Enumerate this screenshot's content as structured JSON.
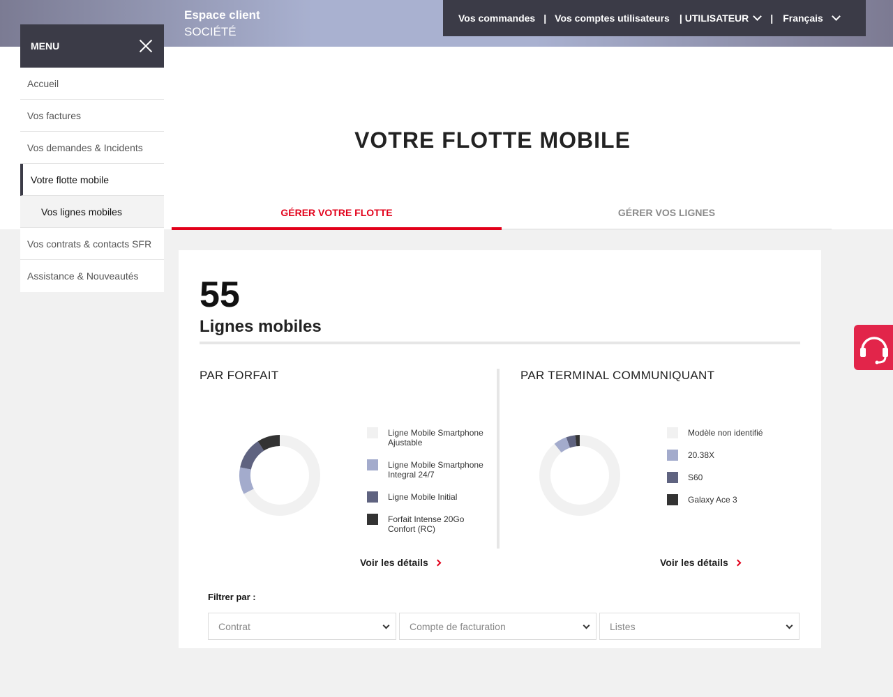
{
  "header": {
    "espace_title": "Espace client",
    "company": "SOCIÉTÉ",
    "nav": {
      "orders": "Vos commandes",
      "accounts": "Vos comptes utilisateurs",
      "user": "UTILISATEUR",
      "language": "Français",
      "separator": "|"
    }
  },
  "sidebar": {
    "menu_label": "MENU",
    "items": [
      {
        "label": "Accueil"
      },
      {
        "label": "Vos factures"
      },
      {
        "label": "Vos demandes & Incidents"
      },
      {
        "label": "Votre flotte mobile"
      },
      {
        "label": "Vos lignes mobiles"
      },
      {
        "label": "Vos contrats & contacts SFR"
      },
      {
        "label": "Assistance & Nouveautés"
      }
    ]
  },
  "page": {
    "title": "VOTRE FLOTTE MOBILE",
    "tabs": [
      {
        "label": "GÉRER VOTRE FLOTTE"
      },
      {
        "label": "GÉRER VOS LIGNES"
      }
    ]
  },
  "summary": {
    "count": "55",
    "count_label": "Lignes mobiles"
  },
  "forfait": {
    "title": "PAR FORFAIT",
    "details": "Voir les détails",
    "legend": [
      {
        "label": "Ligne Mobile Smartphone Ajustable",
        "color": "#f1f1f1"
      },
      {
        "label": "Ligne Mobile Smartphone Integral 24/7",
        "color": "#a3abcc"
      },
      {
        "label": "Ligne Mobile Initial",
        "color": "#5f6380"
      },
      {
        "label": "Forfait Intense 20Go Confort (RC)",
        "color": "#333333"
      }
    ]
  },
  "terminal": {
    "title": "PAR TERMINAL COMMUNIQUANT",
    "details": "Voir les détails",
    "legend": [
      {
        "label": "Modèle non identifié",
        "color": "#f1f1f1"
      },
      {
        "label": "20.38X",
        "color": "#a3abcc"
      },
      {
        "label": "S60",
        "color": "#5f6380"
      },
      {
        "label": "Galaxy Ace 3",
        "color": "#333333"
      }
    ]
  },
  "filters": {
    "label": "Filtrer par :",
    "contract": "Contrat",
    "billing": "Compte de facturation",
    "lists": "Listes"
  },
  "chart_data": [
    {
      "type": "pie",
      "title": "PAR FORFAIT",
      "categories": [
        "Ligne Mobile Smartphone Ajustable",
        "Ligne Mobile Smartphone Integral 24/7",
        "Ligne Mobile Initial",
        "Forfait Intense 20Go Confort (RC)"
      ],
      "values": [
        37,
        6,
        7,
        5
      ]
    },
    {
      "type": "pie",
      "title": "PAR TERMINAL COMMUNIQUANT",
      "categories": [
        "Modèle non identifié",
        "20.38X",
        "S60",
        "Galaxy Ace 3"
      ],
      "values": [
        49,
        3,
        2,
        1
      ]
    }
  ],
  "icons": {
    "close": "close-icon",
    "chevron": "chevron-down-icon",
    "support": "headset-icon"
  }
}
